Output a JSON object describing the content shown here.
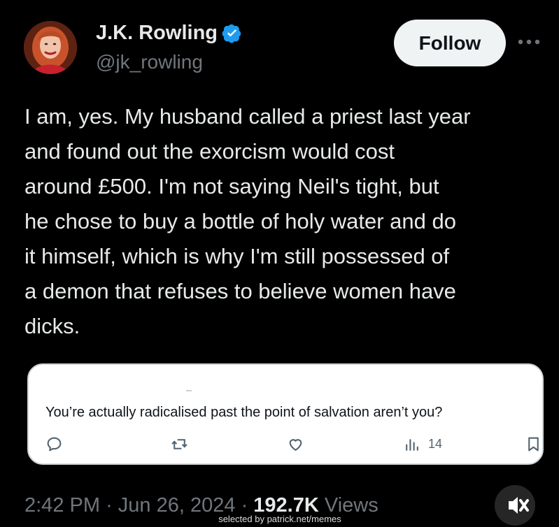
{
  "author": {
    "name": "J.K. Rowling",
    "handle": "@jk_rowling",
    "verified_color": "#1d9bf0"
  },
  "header": {
    "follow_label": "Follow",
    "more_icon": "more-horizontal-icon"
  },
  "tweet": {
    "text": "I am, yes. My husband called a priest last year\nand found out the exorcism would cost\naround £500. I'm not saying Neil's tight, but\nhe chose to buy a bottle of holy water and do\nit himself, which is why I'm still possessed of\na demon that refuses to believe women have\ndicks."
  },
  "quoted_card": {
    "text": "You’re actually radicalised past the point of salvation aren’t you?",
    "views_count": "14",
    "icons": [
      "reply-icon",
      "retweet-icon",
      "like-icon",
      "views-icon",
      "bookmark-icon"
    ]
  },
  "footer": {
    "time": "2:42 PM",
    "separator": "·",
    "date": "Jun 26, 2024",
    "views_count": "192.7K",
    "views_label": "Views",
    "mute_icon": "mute-icon"
  },
  "watermark": "selected by patrick.net/memes",
  "colors": {
    "background": "#000000",
    "primary_text": "#e7e9ea",
    "secondary_text": "#71767b",
    "follow_button": "#eff3f4"
  }
}
